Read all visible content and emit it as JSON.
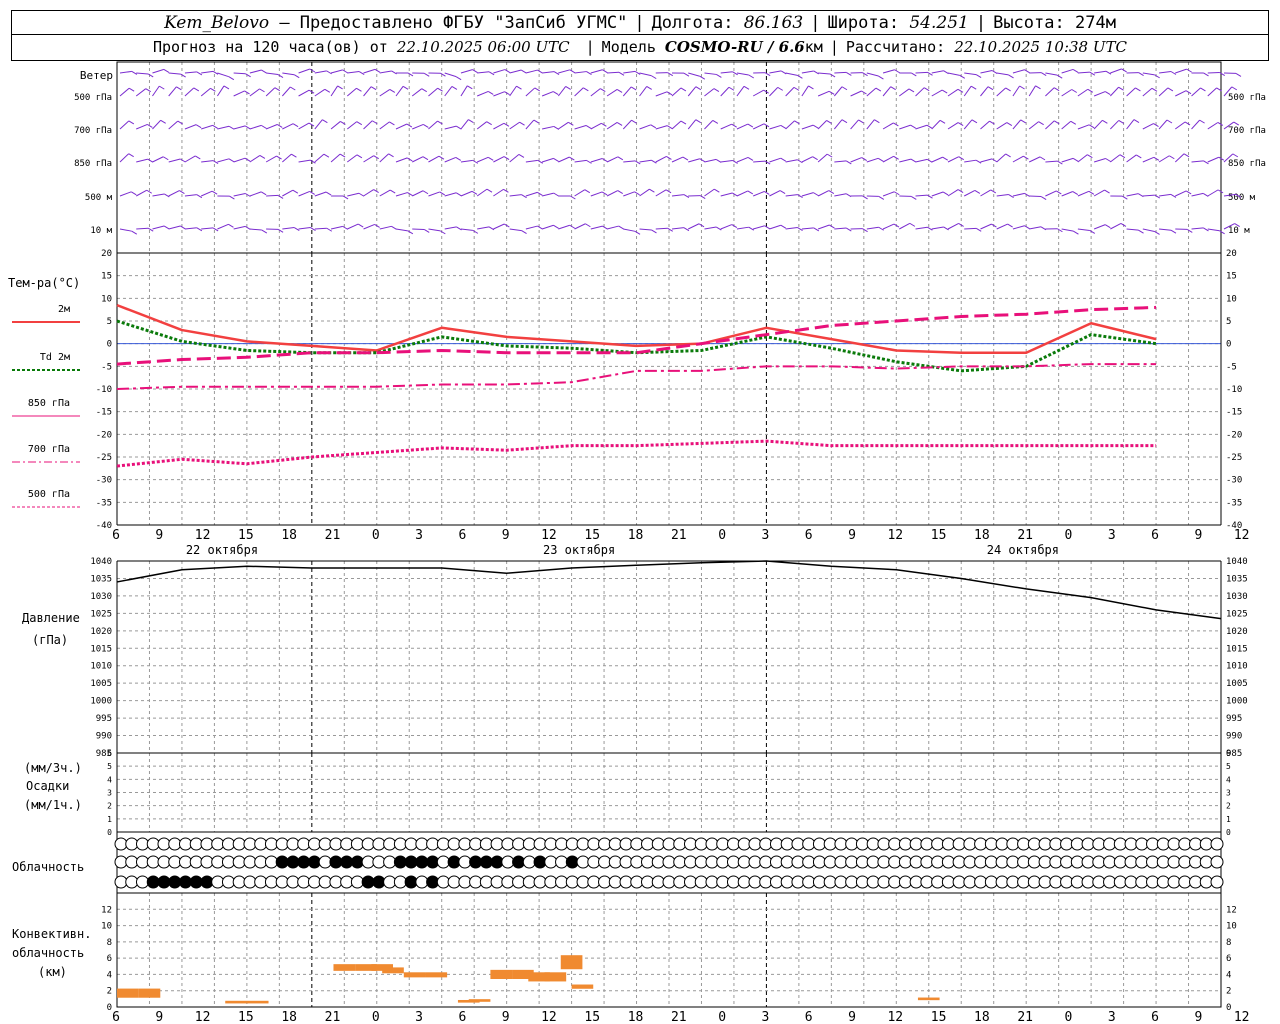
{
  "header": {
    "station": "Kem_Belovo",
    "provider": "— Предоставлено ФГБУ \"ЗапСиб УГМС\"",
    "lon_label": "Долгота:",
    "lon_value": "86.163",
    "lat_label": "Широта:",
    "lat_value": "54.251",
    "alt_label": "Высота:",
    "alt_value": "274м",
    "forecast_text": "Прогноз на 120 часа(ов) от",
    "forecast_date": "22.10.2025 06:00 UTC",
    "model_label": "Модель",
    "model_name": "COSMO-RU / 6.6",
    "model_unit": "км",
    "computed_label": "Рассчитано:",
    "computed_date": "22.10.2025 10:38 UTC"
  },
  "colors": {
    "wind": "#7a2ccf",
    "temp2m": "#f24040",
    "td2m": "#0a7a0a",
    "upper": "#e8107a",
    "pressure": "#000000",
    "conv": "#f08a30",
    "grid": "#999999"
  },
  "chart_data": [
    {
      "type": "wind-barbs",
      "title": "Ветер",
      "levels": [
        "500 гПа",
        "700 гПа",
        "850 гПа",
        "500 м",
        "10 м"
      ]
    },
    {
      "type": "line",
      "ylabel": "Тем-ра(°C)",
      "ylim": [
        -40,
        20
      ],
      "yticks": [
        20,
        15,
        10,
        5,
        0,
        -5,
        -10,
        -15,
        -20,
        -25,
        -30,
        -35,
        -40
      ],
      "x_hours": [
        0,
        6,
        12,
        18,
        24,
        30,
        36,
        42,
        48,
        54,
        60,
        66,
        72,
        78,
        84,
        90,
        96,
        102
      ],
      "series": [
        {
          "name": "2м",
          "values": [
            8.5,
            3,
            0.5,
            -0.5,
            -1.5,
            3.5,
            1.5,
            0.5,
            -0.5,
            0,
            3.5,
            1,
            -1.5,
            -2,
            -2,
            4.5,
            1
          ]
        },
        {
          "name": "Td 2м",
          "values": [
            5,
            0.5,
            -1.5,
            -2,
            -2,
            1.5,
            -0.5,
            -1,
            -2,
            -1.5,
            1.5,
            -1,
            -4,
            -6,
            -5,
            2,
            0
          ]
        },
        {
          "name": "850 гПа",
          "values": [
            -4.5,
            -3.5,
            -3,
            -2,
            -2,
            -1.5,
            -2,
            -2,
            -2,
            0,
            2,
            4,
            5,
            6,
            6.5,
            7.5,
            8
          ]
        },
        {
          "name": "700 гПа",
          "values": [
            -10,
            -9.5,
            -9.5,
            -9.5,
            -9.5,
            -9,
            -9,
            -8.5,
            -6,
            -6,
            -5,
            -5,
            -5.5,
            -5,
            -5,
            -4.5,
            -4.5
          ]
        },
        {
          "name": "500 гПа",
          "values": [
            -27,
            -25.5,
            -26.5,
            -25,
            -24,
            -23,
            -23.5,
            -22.5,
            -22.5,
            -22,
            -21.5,
            -22.5,
            -22.5,
            -22.5,
            -22.5,
            -22.5,
            -22.5
          ]
        }
      ]
    },
    {
      "type": "line",
      "ylabel": "Давление",
      "ylabel2": "(гПа)",
      "ylim": [
        985,
        1040
      ],
      "yticks": [
        1040,
        1035,
        1030,
        1025,
        1020,
        1015,
        1010,
        1005,
        1000,
        995,
        990,
        985
      ],
      "x_hours": [
        0,
        6,
        12,
        18,
        24,
        30,
        36,
        42,
        48,
        54,
        60,
        66,
        72,
        78,
        84,
        90,
        96,
        102
      ],
      "series": [
        {
          "values": [
            1034,
            1037.5,
            1038.5,
            1038,
            1038,
            1038,
            1036.5,
            1038,
            1038.8,
            1039.5,
            1040,
            1038.5,
            1037.5,
            1035,
            1032,
            1029.5,
            1026,
            1023.5
          ]
        }
      ]
    },
    {
      "type": "bar",
      "ylabel_top": "(мм/3ч.)",
      "ylabel_mid": "Осадки",
      "ylabel_bot": "(мм/1ч.)",
      "ylim": [
        0,
        6
      ],
      "yticks": [
        6,
        5,
        4,
        3,
        2,
        1,
        0
      ],
      "values": []
    },
    {
      "type": "cloud-cover",
      "title": "Облачность",
      "rows": 3
    },
    {
      "type": "bar",
      "ylabel": [
        "Конвективн.",
        "облачность",
        "(км)"
      ],
      "ylim": [
        0,
        14
      ],
      "yticks": [
        12,
        10,
        8,
        6,
        4,
        2,
        0
      ],
      "bars": [
        {
          "h": 1.0,
          "base": 1.2,
          "top": 2.2
        },
        {
          "h": 3.0,
          "base": 1.2,
          "top": 2.2
        },
        {
          "h": 11.0,
          "base": 0.5,
          "top": 0.7
        },
        {
          "h": 13.0,
          "base": 0.5,
          "top": 0.7
        },
        {
          "h": 21.0,
          "base": 4.5,
          "top": 5.2
        },
        {
          "h": 23.0,
          "base": 4.5,
          "top": 5.2
        },
        {
          "h": 24.5,
          "base": 4.5,
          "top": 5.2
        },
        {
          "h": 25.5,
          "base": 4.2,
          "top": 4.8
        },
        {
          "h": 27.5,
          "base": 3.7,
          "top": 4.2
        },
        {
          "h": 29.5,
          "base": 3.7,
          "top": 4.2
        },
        {
          "h": 32.5,
          "base": 0.6,
          "top": 0.8
        },
        {
          "h": 33.5,
          "base": 0.7,
          "top": 0.9
        },
        {
          "h": 35.5,
          "base": 3.5,
          "top": 4.5
        },
        {
          "h": 37.5,
          "base": 3.5,
          "top": 4.5
        },
        {
          "h": 39.0,
          "base": 3.2,
          "top": 4.2
        },
        {
          "h": 40.5,
          "base": 3.2,
          "top": 4.2
        },
        {
          "h": 42.0,
          "base": 4.7,
          "top": 6.3
        },
        {
          "h": 43.0,
          "base": 2.3,
          "top": 2.7
        },
        {
          "h": 75.0,
          "base": 0.9,
          "top": 1.1
        }
      ]
    }
  ],
  "xaxis": {
    "tick_labels": [
      "6",
      "9",
      "12",
      "15",
      "18",
      "21",
      "0",
      "3",
      "6",
      "9",
      "12",
      "15",
      "18",
      "21",
      "0",
      "3",
      "6",
      "9",
      "12",
      "15",
      "18",
      "21",
      "0",
      "3",
      "6",
      "9",
      "12"
    ],
    "day_labels": [
      "22 октября",
      "23 октября",
      "24 октября"
    ]
  }
}
